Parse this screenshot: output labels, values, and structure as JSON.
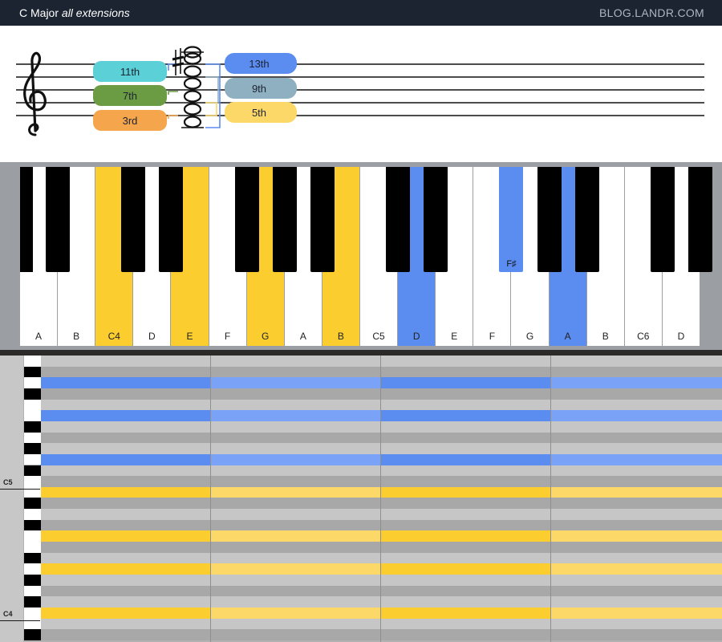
{
  "header": {
    "title_main": "C Major",
    "title_italic": "all extensions",
    "brand": "BLOG.LANDR.COM"
  },
  "staff": {
    "clef": "treble-clef-icon",
    "left_labels": [
      {
        "text": "11th",
        "color": "#5bd0d6"
      },
      {
        "text": "7th",
        "color": "#6b9b43"
      },
      {
        "text": "3rd",
        "color": "#f5a54c"
      }
    ],
    "right_labels": [
      {
        "text": "13th",
        "color": "#5b8cf0"
      },
      {
        "text": "9th",
        "color": "#8fb0c0"
      },
      {
        "text": "5th",
        "color": "#fcd869"
      }
    ]
  },
  "keyboard": {
    "white_keys": [
      {
        "label": "A",
        "color": "#ffffff"
      },
      {
        "label": "B",
        "color": "#ffffff"
      },
      {
        "label": "C4",
        "color": "#fccd2e"
      },
      {
        "label": "D",
        "color": "#ffffff"
      },
      {
        "label": "E",
        "color": "#fccd2e"
      },
      {
        "label": "F",
        "color": "#ffffff"
      },
      {
        "label": "G",
        "color": "#fccd2e"
      },
      {
        "label": "A",
        "color": "#ffffff"
      },
      {
        "label": "B",
        "color": "#fccd2e"
      },
      {
        "label": "C5",
        "color": "#ffffff"
      },
      {
        "label": "D",
        "color": "#5b8cf0"
      },
      {
        "label": "E",
        "color": "#ffffff"
      },
      {
        "label": "F",
        "color": "#ffffff"
      },
      {
        "label": "G",
        "color": "#ffffff"
      },
      {
        "label": "A",
        "color": "#5b8cf0"
      },
      {
        "label": "B",
        "color": "#ffffff"
      },
      {
        "label": "C6",
        "color": "#ffffff"
      },
      {
        "label": "D",
        "color": "#ffffff"
      }
    ],
    "black_keys": [
      {
        "label": "",
        "color": "#000000"
      },
      {
        "label": "",
        "color": "#000000"
      },
      {
        "label": "",
        "color": "#000000"
      },
      {
        "label": "",
        "color": "#000000"
      },
      {
        "label": "",
        "color": "#000000"
      },
      {
        "label": "",
        "color": "#000000"
      },
      {
        "label": "",
        "color": "#000000"
      },
      {
        "label": "",
        "color": "#000000"
      },
      {
        "label": "F♯",
        "color": "#5b8cf0"
      },
      {
        "label": "",
        "color": "#000000"
      },
      {
        "label": "",
        "color": "#000000"
      },
      {
        "label": "",
        "color": "#000000"
      },
      {
        "label": "",
        "color": "#000000"
      }
    ]
  },
  "piano_roll": {
    "octave_labels": [
      "C5",
      "C4"
    ],
    "highlight_colors": {
      "blue": "#5b8cf0",
      "yellow": "#fccd2e"
    }
  }
}
